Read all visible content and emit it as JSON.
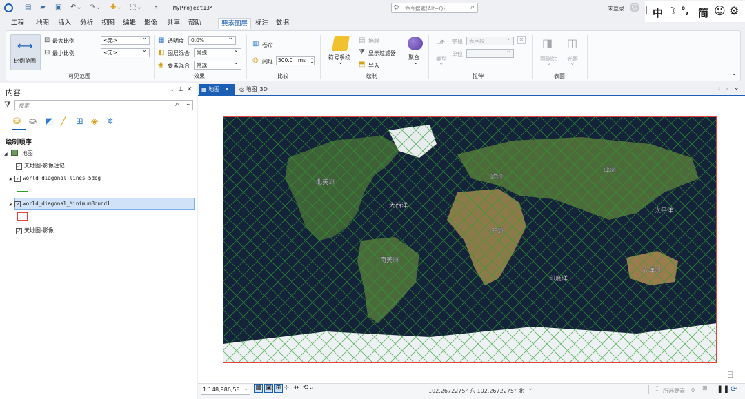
{
  "quick_access": {
    "project_title": "MyProject13",
    "search_placeholder": "命令搜索(Alt+Q)",
    "user_status": "未登录",
    "ime_lang": "中",
    "ime_punct": "°,",
    "ime_script": "简"
  },
  "menu_tabs": [
    "工程",
    "地图",
    "插入",
    "分析",
    "视图",
    "编辑",
    "影像",
    "共享",
    "帮助",
    "要素图层",
    "标注",
    "数据"
  ],
  "active_tab": "要素图层",
  "ribbon": {
    "visible_range": {
      "group_label": "可见范围",
      "button_label": "比例范围",
      "max_scale_label": "最大比例",
      "min_scale_label": "最小比例",
      "max_scale_value": "<无>",
      "min_scale_value": "<无>"
    },
    "effects": {
      "group_label": "效果",
      "transparency_label": "透明度",
      "transparency_value": "0.0%",
      "layer_blend_label": "图层混合",
      "layer_blend_value": "常规",
      "feature_blend_label": "要素混合",
      "feature_blend_value": "常规"
    },
    "compare": {
      "group_label": "比较",
      "swipe_label": "卷帘",
      "flicker_label": "闪烁",
      "flicker_value": "500.0",
      "flicker_unit": "ms"
    },
    "drawing": {
      "group_label": "绘制",
      "symbology_label": "符号系统",
      "vary_label": "掩膜",
      "display_filter_label": "显示过滤器",
      "import_label": "导入",
      "aggregate_label": "聚合"
    },
    "extrusion": {
      "group_label": "拉伸",
      "type_label": "类型",
      "field_label": "字段",
      "field_value": "无字段",
      "unit_label": "单位"
    },
    "surface": {
      "group_label": "表面",
      "face_culling_label": "面剔除",
      "lighting_label": "光照"
    }
  },
  "contents": {
    "title": "内容",
    "search_placeholder": "搜索",
    "drawing_order_label": "绘制顺序",
    "map_name": "地图",
    "layers": [
      {
        "name": "天地图-影像注记",
        "checked": true
      },
      {
        "name": "world_diagonal_lines_5deg",
        "checked": true
      },
      {
        "name": "world_diagonal_MinimumBound1",
        "checked": true,
        "selected": true
      },
      {
        "name": "天地图-影像",
        "checked": true
      }
    ]
  },
  "map_tabs": [
    {
      "label": "地图",
      "active": true
    },
    {
      "label": "地图_3D",
      "active": false
    }
  ],
  "map_labels": {
    "north_america": "北美洲",
    "europe": "欧洲",
    "asia": "亚洲",
    "pacific": "太平洋",
    "atlantic": "大西洋",
    "africa": "非洲",
    "south_america": "南美洲",
    "indian_ocean": "印度洋",
    "oceania": "大洋洲"
  },
  "statusbar": {
    "scale": "1:148,986,58",
    "coordinates": "102.2672275° 东 102.2672275° 北",
    "selected_features_label": "所选要素:",
    "selected_features_count": "0"
  },
  "colors": {
    "accent": "#1a5fb4",
    "grid_line": "#2aa02a",
    "bounding_box": "#e0453a",
    "ocean": "#15233a"
  }
}
